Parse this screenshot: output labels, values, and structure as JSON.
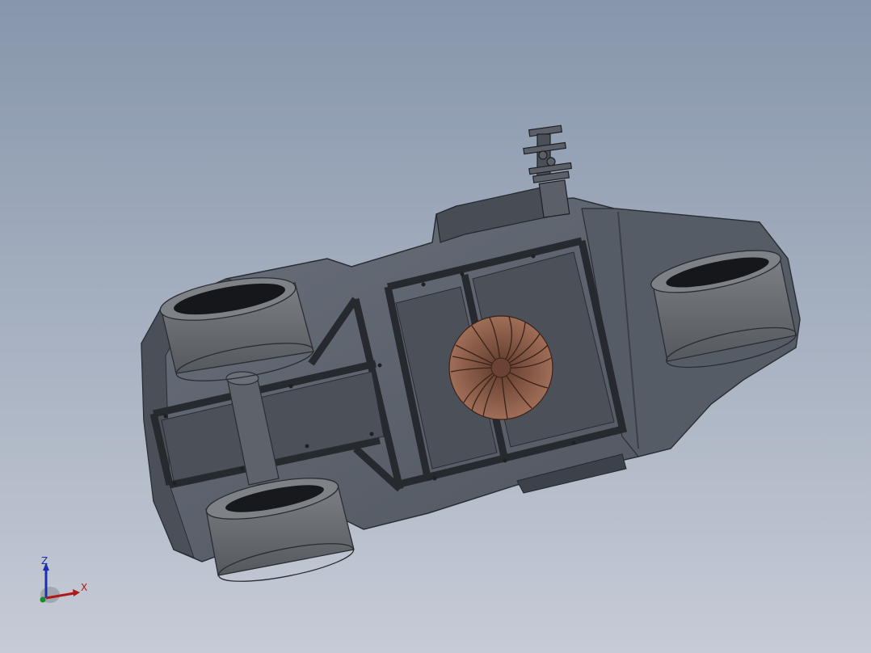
{
  "viewport": {
    "background_top": "#8796ab",
    "background_bottom": "#c6cbd6"
  },
  "model": {
    "body_color": "#5a606b",
    "body_dark": "#3c414a",
    "frame_color": "#26292e",
    "tire_color": "#6b6e73",
    "turbine_color": "#8a5a48"
  },
  "triad": {
    "z_label": "Z",
    "x_label": "X",
    "z_color": "#1d2fb0",
    "x_color": "#b01818",
    "y_color": "#1a8a2a"
  }
}
